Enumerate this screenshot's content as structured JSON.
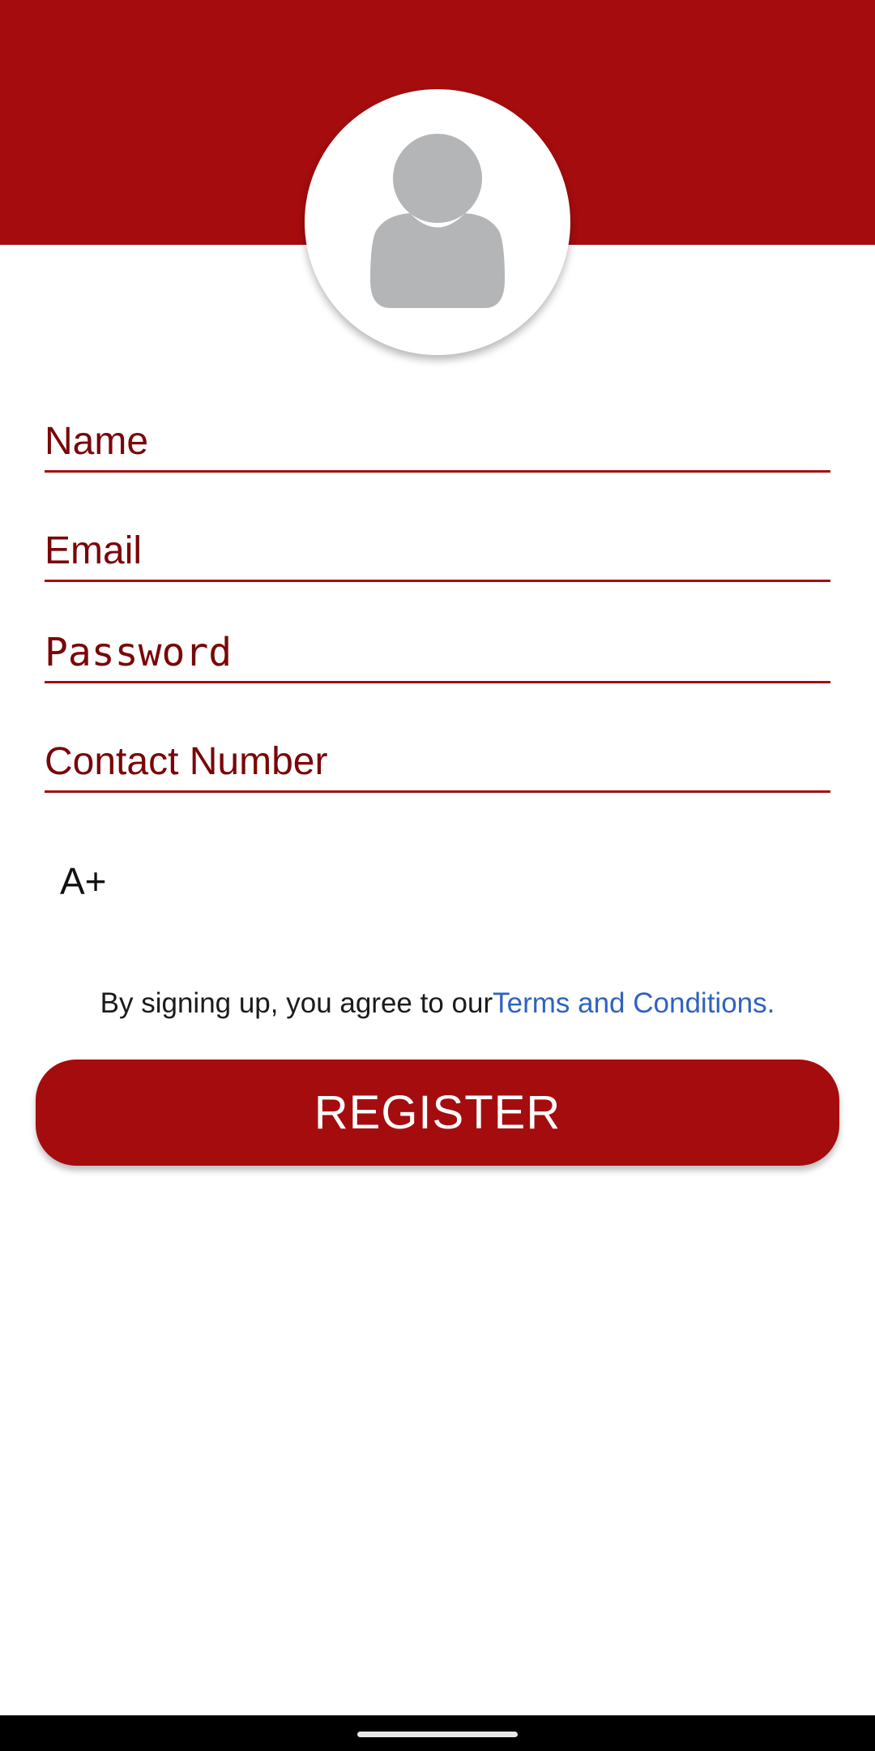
{
  "theme": {
    "primary_color": "#a50c0e",
    "field_text_color": "#7a0608",
    "link_color": "#2f63bf",
    "avatar_icon_color": "#b3b5b7"
  },
  "header": {
    "avatar_icon": "user-silhouette-icon"
  },
  "form": {
    "name": {
      "placeholder": "Name",
      "value": ""
    },
    "email": {
      "placeholder": "Email",
      "value": ""
    },
    "password": {
      "placeholder": "Password",
      "value": ""
    },
    "contact": {
      "placeholder": "Contact Number",
      "value": ""
    },
    "blood_group": {
      "selected": "A+"
    }
  },
  "terms": {
    "prefix": "By signing up, you agree to our",
    "link_text": "Terms and Conditions."
  },
  "register_button": {
    "label": "REGISTER"
  }
}
